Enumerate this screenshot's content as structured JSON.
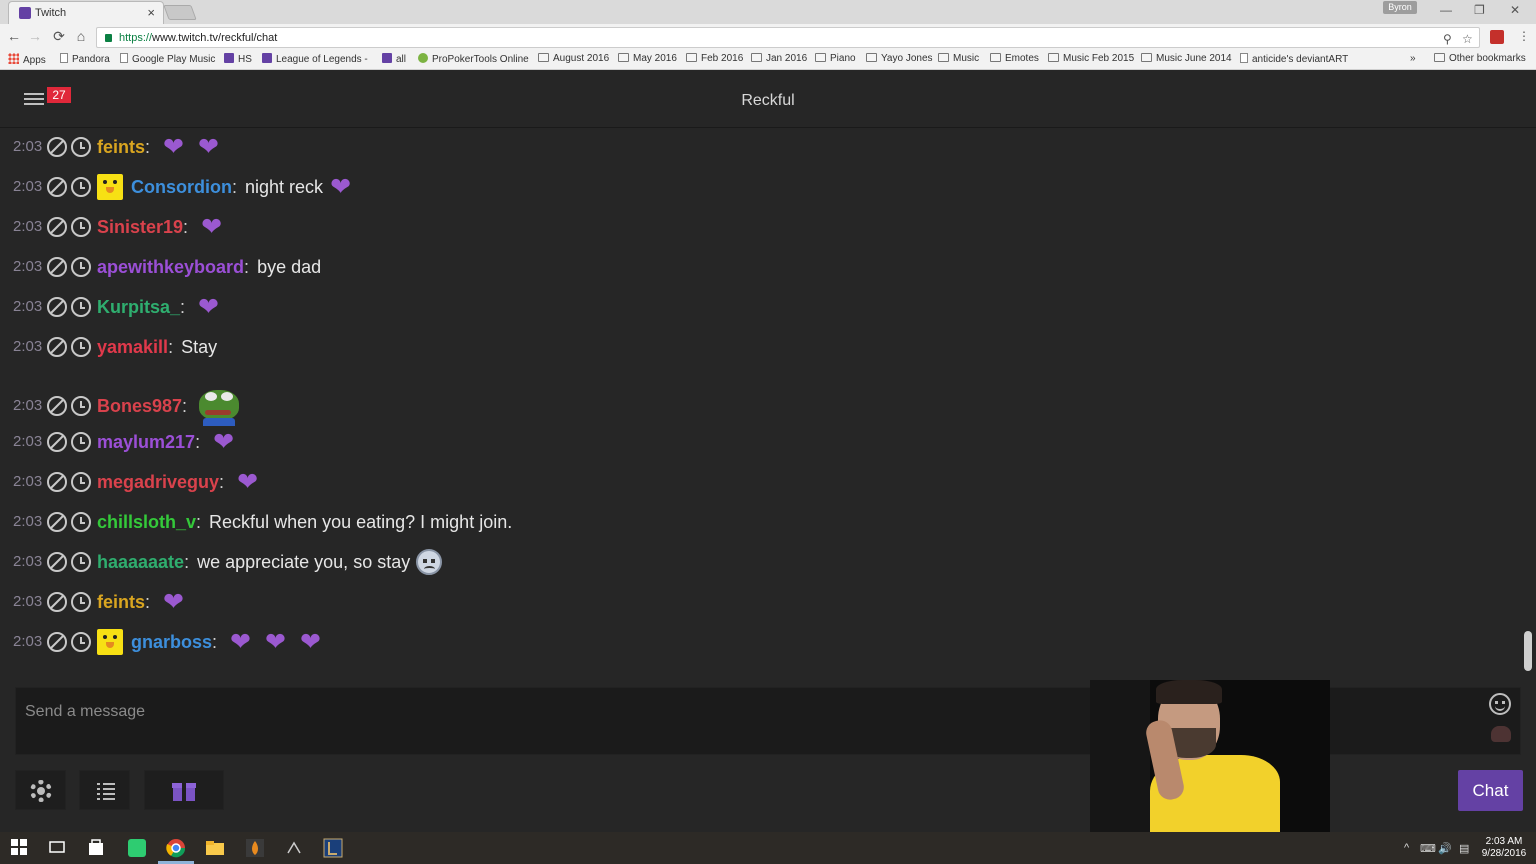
{
  "browser": {
    "tab_title": "Twitch",
    "tab_close": "×",
    "profile_name": "Byron",
    "url_secure": "https://",
    "url_rest": "www.twitch.tv/reckful/chat",
    "window_controls": {
      "minimize": "—",
      "restore": "❐",
      "close": "✕"
    },
    "nav": {
      "back": "←",
      "forward": "→",
      "reload": "⟳",
      "home": "⌂"
    },
    "omni_icons": {
      "zoom": "⚲",
      "star": "☆",
      "menu": "⋮"
    },
    "bookmarks": [
      {
        "label": "Apps",
        "icon": "grid"
      },
      {
        "label": "Pandora",
        "icon": "page"
      },
      {
        "label": "Google Play Music",
        "icon": "page"
      },
      {
        "label": "HS",
        "icon": "twitch"
      },
      {
        "label": "League of Legends - ",
        "icon": "twitch"
      },
      {
        "label": "all",
        "icon": "twitch"
      },
      {
        "label": "ProPokerTools Online",
        "icon": "green"
      },
      {
        "label": "August 2016",
        "icon": "folder"
      },
      {
        "label": "May 2016",
        "icon": "folder"
      },
      {
        "label": "Feb 2016",
        "icon": "folder"
      },
      {
        "label": "Jan 2016",
        "icon": "folder"
      },
      {
        "label": "Piano",
        "icon": "folder"
      },
      {
        "label": "Yayo Jones",
        "icon": "folder"
      },
      {
        "label": "Music",
        "icon": "folder"
      },
      {
        "label": "Emotes",
        "icon": "folder"
      },
      {
        "label": "Music Feb 2015",
        "icon": "folder"
      },
      {
        "label": "Music June 2014",
        "icon": "folder"
      },
      {
        "label": "anticide's deviantART",
        "icon": "page"
      }
    ],
    "bookmarks_overflow": "»",
    "other_bookmarks": "Other bookmarks"
  },
  "chat": {
    "channel": "Reckful",
    "notification_count": "27",
    "messages": [
      {
        "time": "2:03",
        "user": "feints",
        "color": "#d9a520",
        "sub": false,
        "text": "",
        "emotes": [
          "heart",
          "heart"
        ]
      },
      {
        "time": "2:03",
        "user": "Consordion",
        "color": "#3d8fdc",
        "sub": true,
        "text": "night reck",
        "emotes": [
          "heart"
        ]
      },
      {
        "time": "2:03",
        "user": "Sinister19",
        "color": "#d9424c",
        "sub": false,
        "text": "",
        "emotes": [
          "heart"
        ]
      },
      {
        "time": "2:03",
        "user": "apewithkeyboard",
        "color": "#9b4fd6",
        "sub": false,
        "text": "bye dad",
        "emotes": []
      },
      {
        "time": "2:03",
        "user": "Kurpitsa_",
        "color": "#2fae6f",
        "sub": false,
        "text": "",
        "emotes": [
          "heart"
        ]
      },
      {
        "time": "2:03",
        "user": "yamakill",
        "color": "#e0394b",
        "sub": false,
        "text": "Stay",
        "emotes": []
      },
      {
        "time": "2:03",
        "user": "Bones987",
        "color": "#d9424c",
        "sub": false,
        "text": "",
        "emotes": [
          "pepe"
        ]
      },
      {
        "time": "2:03",
        "user": "maylum217",
        "color": "#9b4fd6",
        "sub": false,
        "text": "",
        "emotes": [
          "heart"
        ]
      },
      {
        "time": "2:03",
        "user": "megadriveguy",
        "color": "#d9424c",
        "sub": false,
        "text": "",
        "emotes": [
          "heart"
        ]
      },
      {
        "time": "2:03",
        "user": "chillsloth_v",
        "color": "#34c93a",
        "sub": false,
        "text": "Reckful when you eating? I might join.",
        "emotes": []
      },
      {
        "time": "2:03",
        "user": "haaaaaate",
        "color": "#2fae6f",
        "sub": false,
        "text": "we appreciate you, so stay",
        "emotes": [
          "sad"
        ]
      },
      {
        "time": "2:03",
        "user": "feints",
        "color": "#d9a520",
        "sub": false,
        "text": "",
        "emotes": [
          "heart"
        ]
      },
      {
        "time": "2:03",
        "user": "gnarboss",
        "color": "#3d8fdc",
        "sub": true,
        "text": "",
        "emotes": [
          "heart",
          "heart",
          "heart"
        ]
      }
    ],
    "input_placeholder": "Send a message",
    "chat_button": "Chat"
  },
  "taskbar": {
    "time": "2:03 AM",
    "date": "9/28/2016",
    "apps": [
      "start",
      "task-view",
      "store",
      "app-green",
      "chrome",
      "file-explorer",
      "app-flame",
      "app-steam",
      "app-league"
    ],
    "tray_icons": [
      "^",
      "⌨",
      "🔊",
      "▤"
    ]
  },
  "icons": {
    "heart": "❤"
  }
}
